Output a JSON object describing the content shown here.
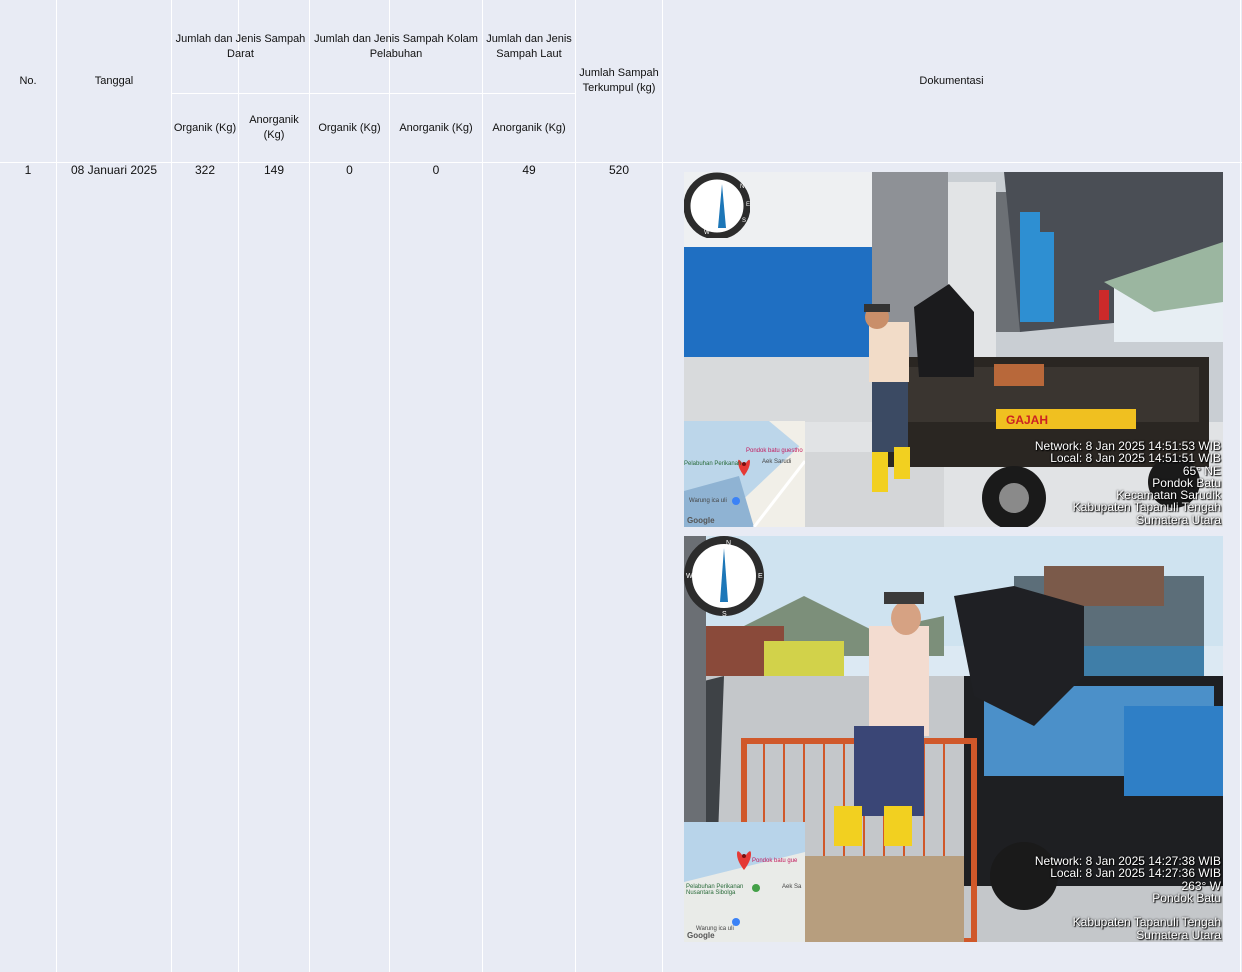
{
  "table": {
    "headers": {
      "no": "No.",
      "tanggal": "Tanggal",
      "darat": "Jumlah dan Jenis Sampah Darat",
      "kolam": "Jumlah dan Jenis Sampah Kolam Pelabuhan",
      "laut": "Jumlah dan Jenis Sampah Laut",
      "terkumpul": "Jumlah Sampah Terkumpul (kg)",
      "dokumentasi": "Dokumentasi",
      "darat_organik": "Organik (Kg)",
      "darat_anorganik": "Anorganik (Kg)",
      "kolam_organik": "Organik (Kg)",
      "kolam_anorganik": "Anorganik (Kg)",
      "laut_anorganik": "Anorganik (Kg)"
    },
    "rows": [
      {
        "no": "1",
        "tanggal": "08 Januari 2025",
        "darat_organik": "322",
        "darat_anorganik": "149",
        "kolam_organik": "0",
        "kolam_anorganik": "0",
        "laut_anorganik": "49",
        "terkumpul": "520"
      }
    ]
  },
  "photos": [
    {
      "overlay_lines": [
        "Network: 8 Jan 2025 14:51:53 WIB",
        "Local: 8 Jan 2025 14:51:51 WIB",
        "65° NE",
        "Pondok Batu",
        "Kecamatan Sarudik",
        "Kabupaten Tapanuli Tengah",
        "Sumatera Utara"
      ],
      "truck_text": "GAJAH",
      "map_labels": [
        "Pondok batu guestho",
        "Aek Sarudi",
        "Warung ica uli",
        "Pelabuhan Perikanan"
      ],
      "google": "Google"
    },
    {
      "overlay_lines": [
        "Network: 8 Jan 2025 14:27:38 WIB",
        "Local: 8 Jan 2025 14:27:36 WIB",
        "263° W",
        "Pondok Batu",
        "",
        "Kabupaten Tapanuli Tengah",
        "Sumatera Utara"
      ],
      "map_labels": [
        "Pondok batu gue",
        "Pelabuhan Perikanan Nusantara Sibolga",
        "Aek Sa",
        "Warung ica uli"
      ],
      "google": "Google"
    }
  ],
  "compass_letters": [
    "N",
    "E",
    "S",
    "W"
  ]
}
